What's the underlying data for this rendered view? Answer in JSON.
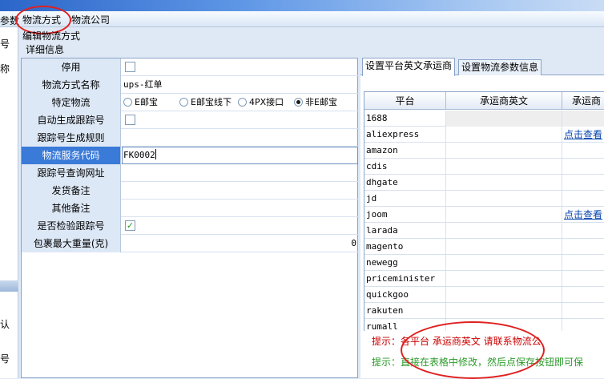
{
  "menubar": {
    "fragment": "参数",
    "items": [
      "物流方式",
      "物流公司"
    ]
  },
  "sidebar": {
    "fragments": [
      "连号",
      "名称",
      "状认",
      "连号"
    ]
  },
  "dialog": {
    "title": "编辑物流方式",
    "group": "详细信息"
  },
  "form": {
    "rows": [
      {
        "label": "停用",
        "checkbox": false
      },
      {
        "label": "物流方式名称",
        "value": "ups-红单"
      },
      {
        "label": "特定物流",
        "radios": [
          "E邮宝",
          "E邮宝线下",
          "4PX接口",
          "非E邮宝"
        ],
        "selected": "非E邮宝"
      },
      {
        "label": "自动生成跟踪号",
        "checkbox": false
      },
      {
        "label": "跟踪号生成规则",
        "value": ""
      },
      {
        "label": "物流服务代码",
        "value": "FK0002"
      },
      {
        "label": "跟踪号查询网址",
        "value": ""
      },
      {
        "label": "发货备注",
        "value": ""
      },
      {
        "label": "其他备注",
        "value": ""
      },
      {
        "label": "是否检验跟踪号",
        "checkbox": true
      },
      {
        "label": "包裹最大重量(克)",
        "value": "0"
      }
    ]
  },
  "right": {
    "tabs": [
      "设置平台英文承运商",
      "设置物流参数信息"
    ],
    "columns": [
      "平台",
      "承运商英文",
      "承运商"
    ],
    "rows": [
      {
        "platform": "1688",
        "carrier_en": "",
        "carrier": ""
      },
      {
        "platform": "aliexpress",
        "carrier_en": "",
        "carrier": "点击查看"
      },
      {
        "platform": "amazon",
        "carrier_en": "",
        "carrier": ""
      },
      {
        "platform": "cdis",
        "carrier_en": "",
        "carrier": ""
      },
      {
        "platform": "dhgate",
        "carrier_en": "",
        "carrier": ""
      },
      {
        "platform": "jd",
        "carrier_en": "",
        "carrier": ""
      },
      {
        "platform": "joom",
        "carrier_en": "",
        "carrier": "点击查看"
      },
      {
        "platform": "larada",
        "carrier_en": "",
        "carrier": ""
      },
      {
        "platform": "magento",
        "carrier_en": "",
        "carrier": ""
      },
      {
        "platform": "newegg",
        "carrier_en": "",
        "carrier": ""
      },
      {
        "platform": "priceminister",
        "carrier_en": "",
        "carrier": ""
      },
      {
        "platform": "quickgoo",
        "carrier_en": "",
        "carrier": ""
      },
      {
        "platform": "rakuten",
        "carrier_en": "",
        "carrier": ""
      },
      {
        "platform": "rumall",
        "carrier_en": "",
        "carrier": ""
      }
    ],
    "tip1": "提示：各平台 承运商英文 请联系物流公",
    "tip2": "提示：直接在表格中修改，然后点保存按钮即可保"
  },
  "colors": {
    "label_bg": "#dde8f6",
    "selected_label": "#3a7ad8",
    "tip_red": "#cc0000",
    "tip_green": "#2a9a2a",
    "highlight_circle": "#e02020"
  }
}
